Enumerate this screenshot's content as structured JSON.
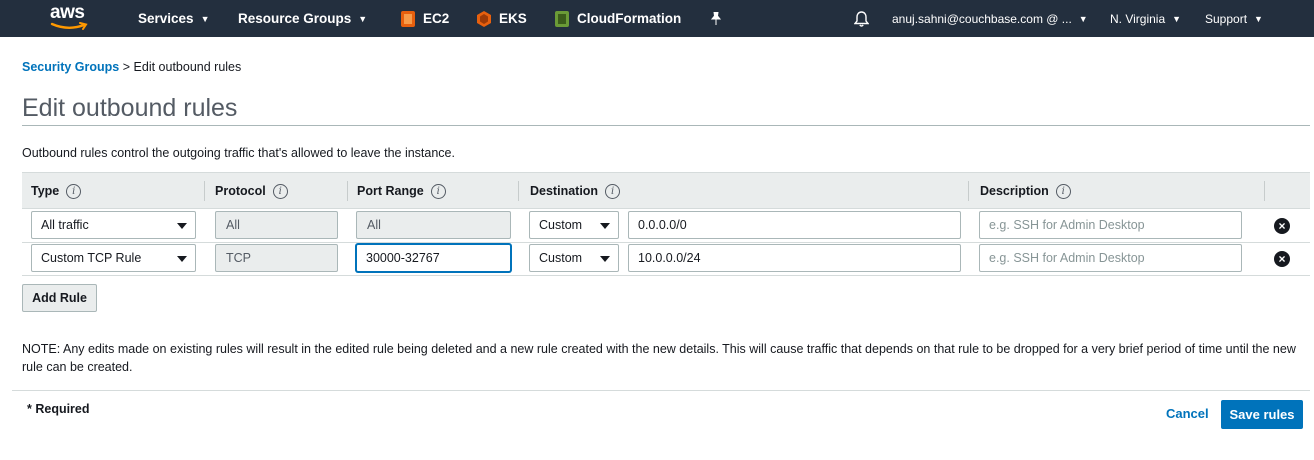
{
  "nav": {
    "logo": "aws",
    "services": "Services",
    "resource_groups": "Resource Groups",
    "shortcuts": [
      {
        "label": "EC2",
        "icon": "ec2-icon",
        "color": "#e7600e"
      },
      {
        "label": "EKS",
        "icon": "eks-icon",
        "color": "#e7600e"
      },
      {
        "label": "CloudFormation",
        "icon": "cloudformation-icon",
        "color": "#6b9b37"
      }
    ],
    "account": "anuj.sahni@couchbase.com @ ...",
    "region": "N. Virginia",
    "support": "Support"
  },
  "breadcrumb": {
    "parent": "Security Groups",
    "separator": ">",
    "current": "Edit outbound rules"
  },
  "page_title": "Edit outbound rules",
  "description": "Outbound rules control the outgoing traffic that's allowed to leave the instance.",
  "table": {
    "headers": {
      "type": "Type",
      "protocol": "Protocol",
      "port_range": "Port Range",
      "destination": "Destination",
      "description": "Description"
    },
    "rows": [
      {
        "type": "All traffic",
        "protocol": "All",
        "port_range": "All",
        "destination_type": "Custom",
        "destination_value": "0.0.0.0/0",
        "description_placeholder": "e.g. SSH for Admin Desktop"
      },
      {
        "type": "Custom TCP Rule",
        "protocol": "TCP",
        "port_range": "30000-32767",
        "destination_type": "Custom",
        "destination_value": "10.0.0.0/24",
        "description_placeholder": "e.g. SSH for Admin Desktop"
      }
    ]
  },
  "add_rule_label": "Add Rule",
  "note": "NOTE: Any edits made on existing rules will result in the edited rule being deleted and a new rule created with the new details. This will cause traffic that depends on that rule to be dropped for a very brief period of time until the new rule can be created.",
  "required_label": "* Required",
  "cancel_label": "Cancel",
  "save_label": "Save rules",
  "colors": {
    "nav_bg": "#232f3e",
    "link": "#0073bb",
    "primary_button": "#0073bb"
  }
}
